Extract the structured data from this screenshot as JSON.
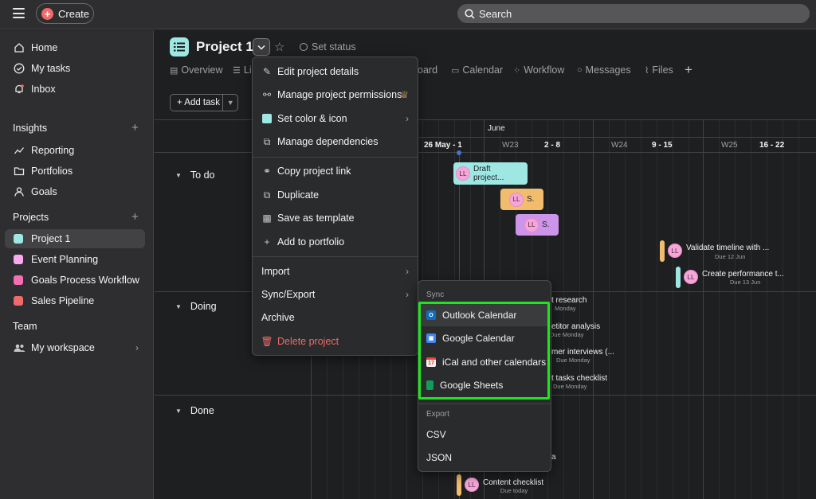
{
  "topbar": {
    "create_label": "Create",
    "search_placeholder": "Search"
  },
  "sidebar": {
    "nav": [
      {
        "label": "Home",
        "icon": "home-icon"
      },
      {
        "label": "My tasks",
        "icon": "check-circle-icon"
      },
      {
        "label": "Inbox",
        "icon": "bell-icon"
      }
    ],
    "insights_heading": "Insights",
    "insights": [
      {
        "label": "Reporting",
        "icon": "chart-icon"
      },
      {
        "label": "Portfolios",
        "icon": "folder-icon"
      },
      {
        "label": "Goals",
        "icon": "person-icon"
      }
    ],
    "projects_heading": "Projects",
    "projects": [
      {
        "label": "Project 1",
        "color": "#9ee7e3"
      },
      {
        "label": "Event Planning",
        "color": "#f9aaef"
      },
      {
        "label": "Goals Process Workflow",
        "color": "#f26fb2"
      },
      {
        "label": "Sales Pipeline",
        "color": "#f06a6a"
      }
    ],
    "team_heading": "Team",
    "team": [
      {
        "label": "My workspace",
        "icon": "people-icon"
      }
    ]
  },
  "header": {
    "project_title": "Project 1",
    "set_status": "Set status",
    "tabs": [
      {
        "label": "Overview"
      },
      {
        "label": "Li"
      },
      {
        "label": "oard"
      },
      {
        "label": "Calendar"
      },
      {
        "label": "Workflow"
      },
      {
        "label": "Messages"
      },
      {
        "label": "Files"
      }
    ],
    "add_tab": "+"
  },
  "toolbar": {
    "add_task": "+ Add task"
  },
  "timeline": {
    "months": [
      "June"
    ],
    "weeks": [
      {
        "label": "26 May - 1"
      },
      {
        "label": "W23"
      },
      {
        "label": "2 - 8"
      },
      {
        "label": "W24"
      },
      {
        "label": "9 - 15"
      },
      {
        "label": "W25"
      },
      {
        "label": "16 - 22"
      }
    ],
    "groups": [
      {
        "label": "To do"
      },
      {
        "label": "Doing"
      },
      {
        "label": "Done"
      }
    ],
    "avatar_initials": "LL",
    "tasks": [
      {
        "title": "Draft project...",
        "color": "#9ee7e3"
      },
      {
        "title": "S.",
        "color": "#f1bd6c"
      },
      {
        "title": "S.",
        "color": "#cd95ea"
      },
      {
        "title": "Validate timeline with ...",
        "due": "Due 12 Jun",
        "color": "#f1bd6c"
      },
      {
        "title": "Create performance t...",
        "due": "Due 13 Jun",
        "color": "#9ee7e3"
      },
      {
        "title": "t research",
        "due": "Monday"
      },
      {
        "title": "etitor analysis",
        "due": "Due Monday"
      },
      {
        "title": "mer interviews (...",
        "due": "Due Monday"
      },
      {
        "title": "t tasks checklist",
        "due": "Due Monday"
      },
      {
        "title": "a"
      },
      {
        "title": "Content checklist",
        "due": "Due today",
        "color": "#f1bd6c"
      }
    ]
  },
  "project_menu": {
    "items": [
      {
        "label": "Edit project details",
        "icon": "pencil-icon"
      },
      {
        "label": "Manage project permissions",
        "icon": "permissions-icon"
      },
      {
        "label": "Set color & icon",
        "icon": "color-swatch-icon"
      },
      {
        "label": "Manage dependencies",
        "icon": "dependencies-icon"
      },
      {
        "label": "Copy project link",
        "icon": "link-icon"
      },
      {
        "label": "Duplicate",
        "icon": "duplicate-icon"
      },
      {
        "label": "Save as template",
        "icon": "template-icon"
      },
      {
        "label": "Add to portfolio",
        "icon": "plus-icon"
      },
      {
        "label": "Import"
      },
      {
        "label": "Sync/Export"
      },
      {
        "label": "Archive"
      },
      {
        "label": "Delete project",
        "icon": "trash-icon"
      }
    ]
  },
  "sync_menu": {
    "sync_heading": "Sync",
    "sync_items": [
      {
        "label": "Outlook Calendar",
        "icon": "outlook-icon",
        "color": "#0f6cbd"
      },
      {
        "label": "Google Calendar",
        "icon": "google-calendar-icon",
        "color": "#4285f4"
      },
      {
        "label": "iCal and other calendars",
        "icon": "ical-icon",
        "color": "#e94235"
      },
      {
        "label": "Google Sheets",
        "icon": "google-sheets-icon",
        "color": "#0f9d58"
      }
    ],
    "export_heading": "Export",
    "export_items": [
      {
        "label": "CSV"
      },
      {
        "label": "JSON"
      }
    ]
  }
}
